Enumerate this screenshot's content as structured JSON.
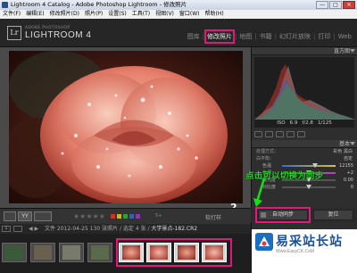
{
  "window": {
    "title": "Lightroom 4 Catalog - Adobe Photoshop Lightroom - 修改照片",
    "minimize": "—",
    "maximize": "□",
    "close": "✕"
  },
  "menubar": [
    "文件(F)",
    "编辑(E)",
    "修改照片(D)",
    "照片(P)",
    "设置(S)",
    "工具(T)",
    "视图(V)",
    "窗口(W)",
    "帮助(H)"
  ],
  "identity": {
    "small": "ADOBE PHOTOSHOP",
    "big": "LIGHTROOM 4",
    "logo": "Lr"
  },
  "modules": [
    {
      "label": "图库",
      "active": false
    },
    {
      "label": "修改照片",
      "active": true
    },
    {
      "label": "地图",
      "active": false
    },
    {
      "label": "书籍",
      "active": false
    },
    {
      "label": "幻灯片放映",
      "active": false
    },
    {
      "label": "打印",
      "active": false
    },
    {
      "label": "Web",
      "active": false
    }
  ],
  "right_panel": {
    "histogram_title": "直方图",
    "histo_info": [
      "ISO",
      "6.9",
      "f/2.8",
      "1/125"
    ],
    "basic_title": "基本",
    "treatment_label": "处理方式：",
    "treatment_color": "彩色",
    "treatment_bw": "黑白",
    "wb_label": "白平衡：",
    "wb_value": "自定",
    "sliders": [
      {
        "label": "色温",
        "value": "12155",
        "pos": 0.62
      },
      {
        "label": "色调",
        "value": "+2",
        "pos": 0.5
      },
      {
        "label": "曝光度",
        "value": "0.00",
        "pos": 0.5
      },
      {
        "label": "对比度",
        "value": "0",
        "pos": 0.5
      }
    ]
  },
  "toolbar": {
    "view2": "YY",
    "view3": "",
    "stars": "★★★★★",
    "label_text": "5+",
    "softproof": "软打样",
    "colors": [
      "#c0392b",
      "#d4b21a",
      "#3a9a3a",
      "#2f62c0",
      "#8a3aa8"
    ]
  },
  "buttons": {
    "sync": "自动同步",
    "reset": "复位"
  },
  "filmbar": {
    "nums": "1",
    "arrows": "◀ ▶",
    "path_prefix": "文件 2012-04-25",
    "path_middle": "130 张照片 / 选定 4 张 /",
    "path_file": "大学景点-182.CR2"
  },
  "annotations": {
    "badge1": "1",
    "badge2": "2",
    "callout": "点击可以切换为同步"
  },
  "watermark": {
    "title": "易采站长站",
    "url": "Www.EasyCK.CoM"
  }
}
